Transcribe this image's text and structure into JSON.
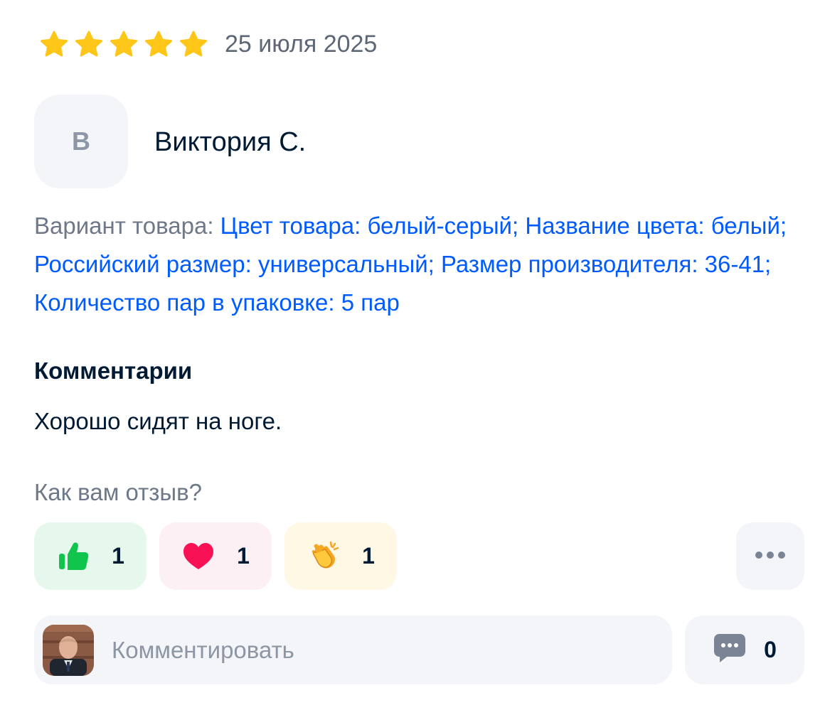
{
  "review": {
    "rating": 5,
    "rating_max": 5,
    "date": "25 июля 2025",
    "author": {
      "initial": "В",
      "name": "Виктория С."
    },
    "variant": {
      "label": "Вариант товара:",
      "value": "Цвет товара: белый-серый; Название цвета: белый; Российский размер: универсальный; Размер производителя: 36-41; Количество пар в упаковке: 5 пар"
    },
    "comments_heading": "Комментарии",
    "comment_text": "Хорошо сидят на ноге."
  },
  "feedback": {
    "question": "Как вам отзыв?",
    "reactions": [
      {
        "icon": "thumbs-up-icon",
        "count": "1"
      },
      {
        "icon": "heart-icon",
        "count": "1"
      },
      {
        "icon": "clapping-hands-icon",
        "count": "1"
      }
    ],
    "more_icon": "more-dots-icon"
  },
  "comment_input": {
    "placeholder": "Комментировать",
    "comments_count": "0",
    "comments_icon": "chat-bubble-icon"
  },
  "colors": {
    "star": "#ffc61a",
    "link": "#005bff",
    "like_bg": "#e6f8ec",
    "like_icon": "#10c44c",
    "heart_bg": "#fdf0f4",
    "heart_icon": "#f91155",
    "clap_bg": "#fff8e4",
    "muted_text": "#6e7888"
  }
}
